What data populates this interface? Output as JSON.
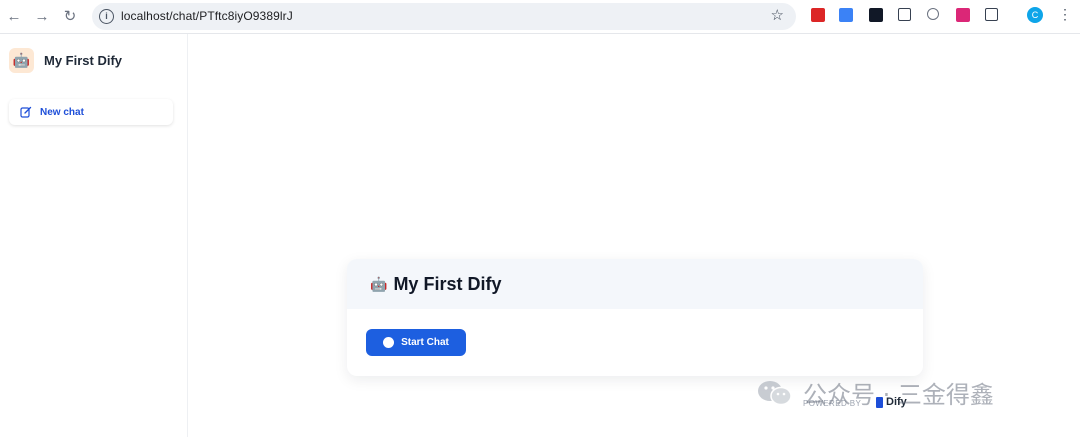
{
  "browser": {
    "url": "localhost/chat/PTftc8iyO9389lrJ",
    "profile_initial": "C",
    "icons": [
      "back-arrow-icon",
      "forward-arrow-icon",
      "reload-icon",
      "info-icon",
      "star-icon",
      "extension-icon",
      "puzzle-icon",
      "kebab-menu-icon"
    ]
  },
  "sidebar": {
    "app_title": "My First Dify",
    "app_emoji": "🤖",
    "new_chat_label": "New chat"
  },
  "welcome": {
    "emoji": "🤖",
    "title": "My First Dify",
    "start_label": "Start Chat"
  },
  "footer": {
    "powered_by": "POWERED BY",
    "brand": "Dify"
  },
  "watermark": {
    "text": "公众号 · 三金得鑫"
  },
  "colors": {
    "accent": "#1d5fe0",
    "link": "#1d4ed8",
    "card_header": "#f4f7fb"
  }
}
